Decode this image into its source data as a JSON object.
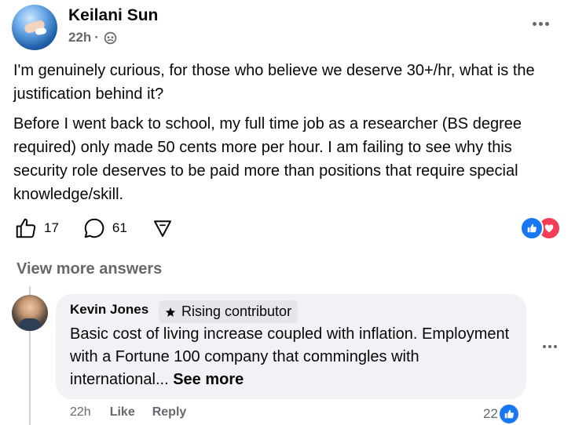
{
  "post": {
    "author": "Keilani Sun",
    "time": "22h",
    "separator": "·",
    "paragraph1": "I'm genuinely curious, for those who believe we deserve 30+/hr, what is the justification behind it?",
    "paragraph2": "Before I went back to school, my full time job as a researcher (BS degree required) only made 50 cents more per hour. I am failing to see why this security role deserves to be paid more than positions that require special knowledge/skill.",
    "upvotes": "17",
    "comments": "61",
    "reactions": [
      "like-reaction-icon",
      "love-reaction-icon"
    ],
    "colors": {
      "like": "#1877f2",
      "love": "#f33e58"
    }
  },
  "view_more": "View more answers",
  "comment": {
    "author": "Kevin Jones",
    "badge": "Rising contributor",
    "text": "Basic cost of living increase coupled with inflation. Employment with a Fortune 100 company that commingles with international... ",
    "see_more": "See more",
    "time": "22h",
    "like_label": "Like",
    "reply_label": "Reply",
    "reaction_count": "22"
  }
}
